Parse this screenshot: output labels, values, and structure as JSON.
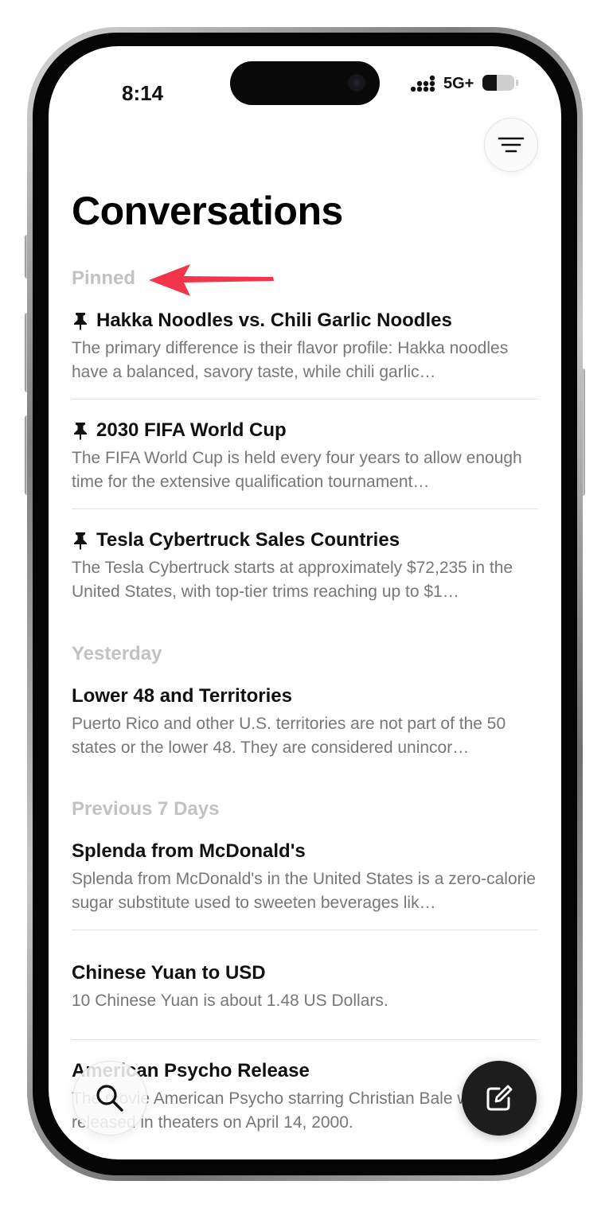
{
  "status_bar": {
    "time": "8:14",
    "network": "5G+",
    "battery_level": 0.45
  },
  "header": {
    "title": "Conversations",
    "menu_icon": "lines-menu-icon"
  },
  "sections": [
    {
      "label": "Pinned",
      "items": [
        {
          "title": "Hakka Noodles vs. Chili Garlic Noodles",
          "pinned": true,
          "preview": "The primary difference is their flavor profile: Hakka noodles have a balanced, savory taste, while chili garlic…"
        },
        {
          "title": "2030 FIFA World Cup",
          "pinned": true,
          "preview": "The FIFA World Cup is held every four years to allow enough time for the extensive qualification tournament…"
        },
        {
          "title": "Tesla Cybertruck Sales Countries",
          "pinned": true,
          "preview": "The Tesla Cybertruck starts at approximately $72,235 in the United States, with top-tier trims reaching up to $1…"
        }
      ]
    },
    {
      "label": "Yesterday",
      "items": [
        {
          "title": "Lower 48 and Territories",
          "pinned": false,
          "preview": "Puerto Rico and other U.S. territories are not part of the 50 states or the lower 48. They are considered unincor…"
        }
      ]
    },
    {
      "label": "Previous 7 Days",
      "items": [
        {
          "title": "Splenda from McDonald's",
          "pinned": false,
          "preview": "Splenda from McDonald's in the United States is a zero-calorie sugar substitute used to sweeten beverages lik…"
        },
        {
          "title": "Chinese Yuan to USD",
          "pinned": false,
          "preview": "10 Chinese Yuan is about 1.48 US Dollars."
        },
        {
          "title": "American Psycho Release",
          "pinned": false,
          "preview": "The movie American Psycho starring Christian Bale was released in theaters on April 14, 2000."
        }
      ]
    }
  ],
  "colors": {
    "section_header": "#c2c2c2",
    "annotation_arrow": "#f2354a",
    "compose_button": "#1d1d1d"
  },
  "floating_buttons": {
    "search_icon": "search-icon",
    "compose_icon": "compose-icon"
  }
}
